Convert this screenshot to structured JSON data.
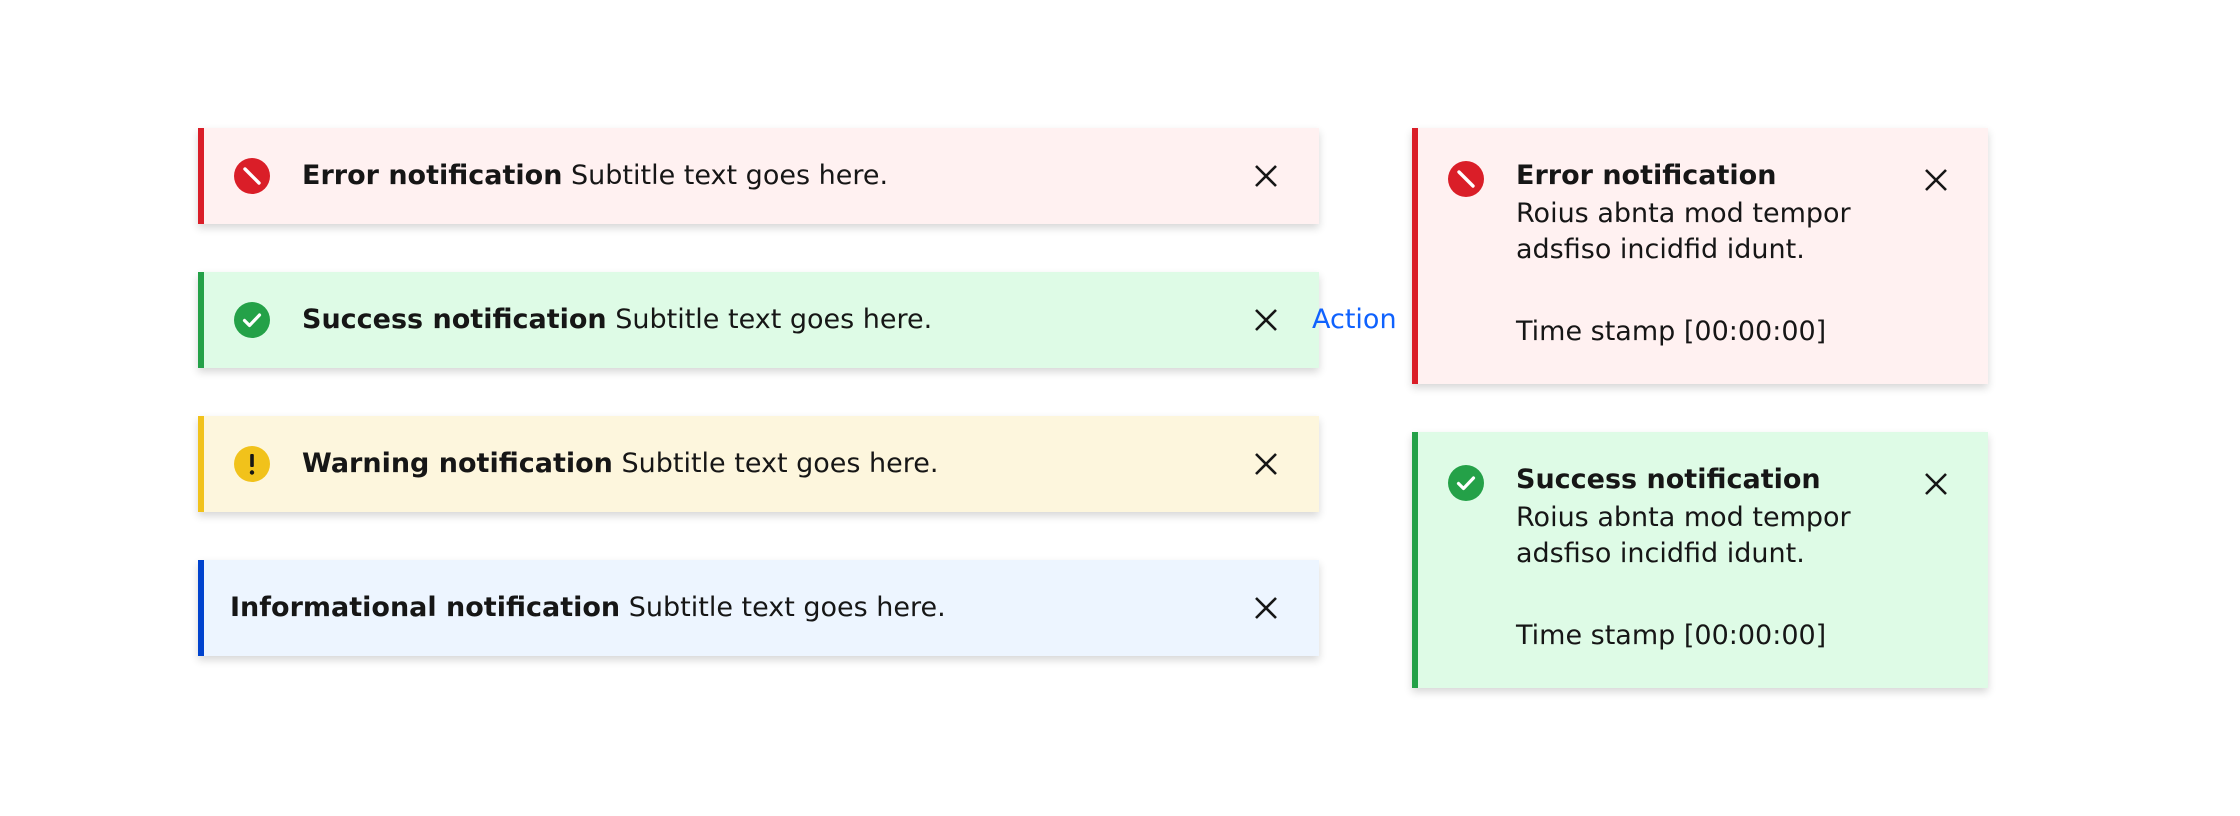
{
  "inline": [
    {
      "kind": "error",
      "icon": "error-icon",
      "title": "Error notification",
      "subtitle": "Subtitle text goes here.",
      "close_icon": "close-icon"
    },
    {
      "kind": "success",
      "icon": "checkmark-icon",
      "title": "Success notification",
      "subtitle": "Subtitle text goes here.",
      "action_label": "Action",
      "close_icon": "close-icon"
    },
    {
      "kind": "warning",
      "icon": "warning-icon",
      "title": "Warning notification",
      "subtitle": "Subtitle text goes here.",
      "close_icon": "close-icon"
    },
    {
      "kind": "info",
      "title": "Informational notification",
      "subtitle": "Subtitle text goes here.",
      "close_icon": "close-icon"
    }
  ],
  "toast": [
    {
      "kind": "error",
      "icon": "error-icon",
      "title": "Error notification",
      "subtitle": "Roius abnta mod tempor adsfiso incidfid idunt.",
      "timestamp": "Time stamp [00:00:00]",
      "close_icon": "close-icon"
    },
    {
      "kind": "success",
      "icon": "checkmark-icon",
      "title": "Success notification",
      "subtitle": "Roius abnta mod tempor adsfiso incidfid idunt.",
      "timestamp": "Time stamp [00:00:00]",
      "close_icon": "close-icon"
    }
  ],
  "colors": {
    "error": "#da1e28",
    "success": "#24a148",
    "warning": "#f1c21b",
    "info": "#0043ce",
    "error_bg": "#fff1f1",
    "success_bg": "#defbe6",
    "warning_bg": "#fdf6dd",
    "info_bg": "#edf5ff",
    "action": "#0f62fe"
  }
}
